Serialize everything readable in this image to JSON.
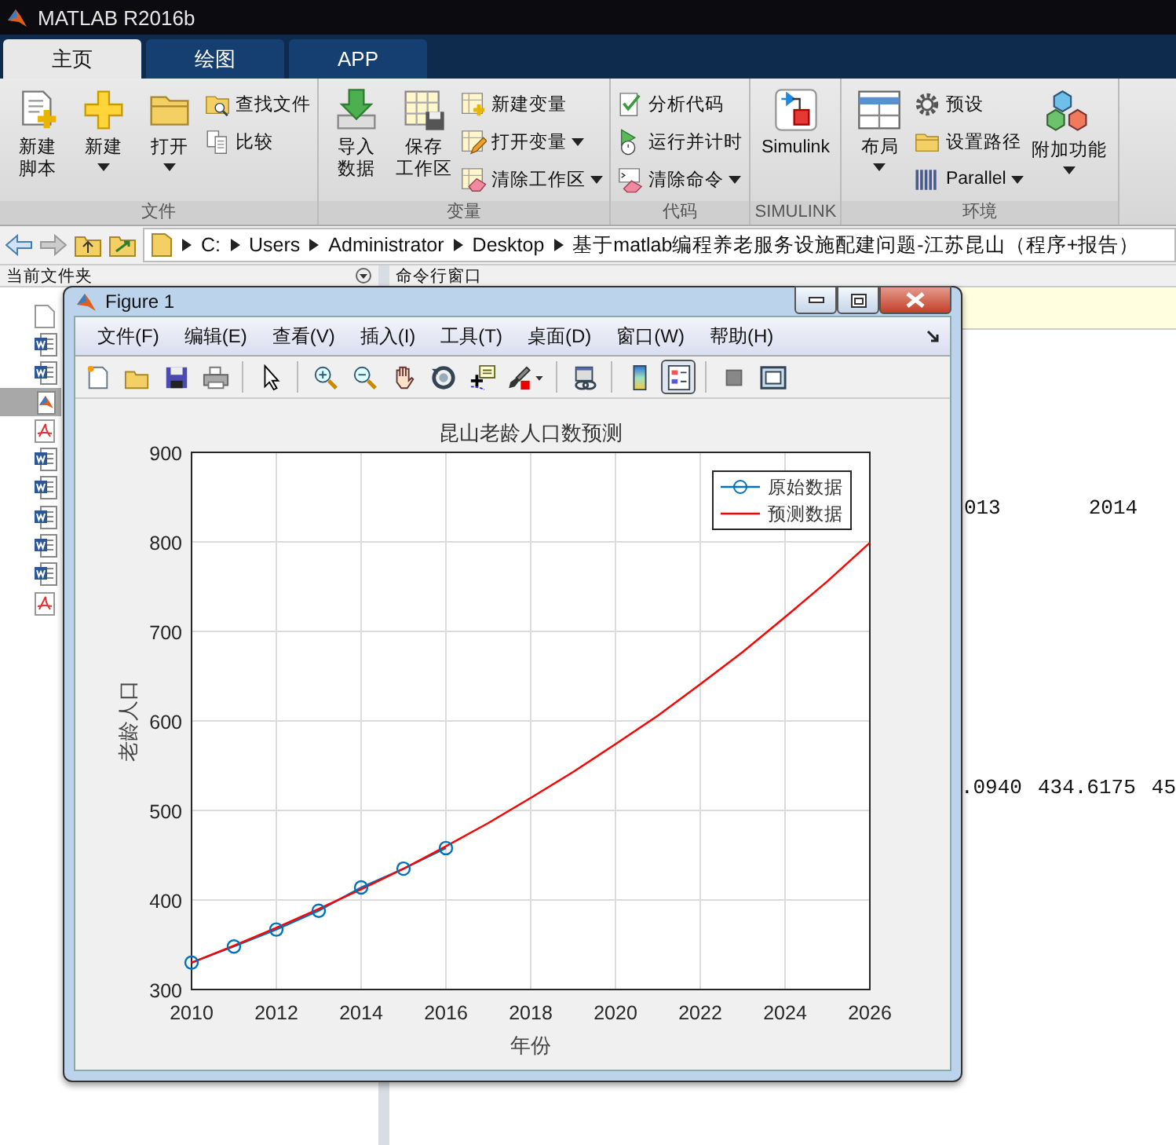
{
  "window": {
    "title": "MATLAB R2016b"
  },
  "tabs": [
    {
      "label": "主页",
      "selected": true
    },
    {
      "label": "绘图",
      "selected": false
    },
    {
      "label": "APP",
      "selected": false
    }
  ],
  "ribbon": {
    "sections": [
      {
        "title": "文件",
        "large": [
          {
            "lines": [
              "新建",
              "脚本"
            ],
            "dropdown": false
          },
          {
            "lines": [
              "新建"
            ],
            "dropdown": true
          },
          {
            "lines": [
              "打开"
            ],
            "dropdown": true
          }
        ],
        "small": [
          {
            "label": "查找文件",
            "dropdown": false
          },
          {
            "label": "比较",
            "dropdown": false
          }
        ]
      },
      {
        "title": "变量",
        "large": [
          {
            "lines": [
              "导入",
              "数据"
            ],
            "dropdown": false
          },
          {
            "lines": [
              "保存",
              "工作区"
            ],
            "dropdown": false
          }
        ],
        "small": [
          {
            "label": "新建变量",
            "dropdown": false
          },
          {
            "label": "打开变量",
            "dropdown": true
          },
          {
            "label": "清除工作区",
            "dropdown": true
          }
        ]
      },
      {
        "title": "代码",
        "small": [
          {
            "label": "分析代码",
            "dropdown": false
          },
          {
            "label": "运行并计时",
            "dropdown": false
          },
          {
            "label": "清除命令",
            "dropdown": true
          }
        ]
      },
      {
        "title": "SIMULINK",
        "large": [
          {
            "lines": [
              "Simulink"
            ],
            "dropdown": false
          }
        ]
      },
      {
        "title": "环境",
        "large": [
          {
            "lines": [
              "布局"
            ],
            "dropdown": true
          }
        ],
        "small": [
          {
            "label": "预设",
            "dropdown": false
          },
          {
            "label": "设置路径",
            "dropdown": false
          },
          {
            "label": "Parallel",
            "dropdown": true
          }
        ],
        "large_after": [
          {
            "lines": [
              "附加功能"
            ],
            "dropdown": true
          }
        ]
      }
    ]
  },
  "address_bar": {
    "path": [
      "C:",
      "Users",
      "Administrator",
      "Desktop",
      "基于matlab编程养老服务设施配建问题-江苏昆山（程序+报告）"
    ]
  },
  "current_folder": {
    "title": "当前文件夹",
    "files": [
      {
        "kind": "blank",
        "selected": false
      },
      {
        "kind": "word",
        "selected": false
      },
      {
        "kind": "word",
        "selected": false
      },
      {
        "kind": "matlab",
        "selected": true
      },
      {
        "kind": "pdf",
        "selected": false
      },
      {
        "kind": "word",
        "selected": false
      },
      {
        "kind": "word",
        "selected": false
      },
      {
        "kind": "word",
        "selected": false
      },
      {
        "kind": "word",
        "selected": false
      },
      {
        "kind": "word",
        "selected": false
      },
      {
        "kind": "pdf",
        "selected": false
      }
    ]
  },
  "command_window": {
    "title": "命令行窗口",
    "lines": [
      [
        "013",
        "2014"
      ],
      [
        ".0940",
        "434.6175",
        "45"
      ]
    ]
  },
  "figure": {
    "title": "Figure 1",
    "menus": [
      "文件(F)",
      "编辑(E)",
      "查看(V)",
      "插入(I)",
      "工具(T)",
      "桌面(D)",
      "窗口(W)",
      "帮助(H)"
    ],
    "toolbar": [
      [
        {
          "pressed": false
        },
        {
          "pressed": false
        },
        {
          "pressed": false
        },
        {
          "pressed": false
        }
      ],
      [
        {
          "pressed": false
        }
      ],
      [
        {
          "pressed": false
        },
        {
          "pressed": false
        },
        {
          "pressed": false
        },
        {
          "pressed": false
        },
        {
          "pressed": false
        },
        {
          "pressed": false
        }
      ],
      [
        {
          "pressed": false
        }
      ],
      [
        {
          "pressed": false
        },
        {
          "pressed": true
        }
      ],
      [
        {
          "pressed": false
        },
        {
          "pressed": false
        }
      ]
    ],
    "chart_data": {
      "type": "line",
      "title": "昆山老龄人口数预测",
      "xlabel": "年份",
      "ylabel": "老龄人口",
      "x": [
        2010,
        2011,
        2012,
        2013,
        2014,
        2015,
        2016,
        2017,
        2018,
        2019,
        2020,
        2021,
        2022,
        2023,
        2024,
        2025,
        2026
      ],
      "series": [
        {
          "name": "原始数据",
          "color": "#0072bd",
          "marker": "circle",
          "values": [
            330,
            348,
            367,
            388,
            414,
            435,
            458,
            null,
            null,
            null,
            null,
            null,
            null,
            null,
            null,
            null,
            null
          ]
        },
        {
          "name": "预测数据",
          "color": "#ff0000",
          "values": [
            330,
            349,
            369,
            390,
            412,
            435,
            460,
            486,
            514,
            543,
            574,
            606,
            641,
            677,
            716,
            756,
            799
          ]
        }
      ],
      "grid": true,
      "legend": true,
      "xlim": [
        2010,
        2026
      ],
      "ylim": [
        300,
        900
      ],
      "xticks": [
        2010,
        2012,
        2014,
        2016,
        2018,
        2020,
        2022,
        2024,
        2026
      ],
      "yticks": [
        300,
        400,
        500,
        600,
        700,
        800,
        900
      ]
    }
  }
}
